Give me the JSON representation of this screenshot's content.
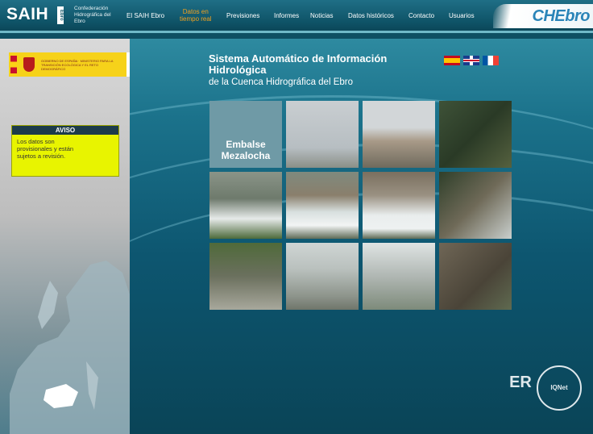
{
  "header": {
    "logo": "SAIH",
    "logo_sub": "Ebro",
    "org": "Confederación Hidrográfica del Ebro",
    "brand": "CHEbro",
    "nav": [
      {
        "label": "El SAIH Ebro"
      },
      {
        "label": "Datos en\ntiempo real"
      },
      {
        "label": "Previsiones"
      },
      {
        "label": "Informes"
      },
      {
        "label": "Noticias"
      },
      {
        "label": "Datos históricos"
      },
      {
        "label": "Contacto"
      },
      {
        "label": "Usuarios"
      }
    ]
  },
  "sidebar": {
    "ministry_logo_text": "GOBIERNO DE ESPAÑA · MINISTERIO PARA LA TRANSICIÓN ECOLÓGICA Y EL RETO DEMOGRÁFICO",
    "che_logo_text": "CONFEDERACIÓN HIDROGRÁFICA DEL EBRO",
    "aviso_title": "AVISO",
    "aviso_text": "Los datos son provisionales y están sujetos a revisión."
  },
  "main": {
    "title": "Sistema Automático de Información Hidrológica",
    "subtitle": "de la Cuenca Hidrográfica del Ebro",
    "languages": [
      "es",
      "en",
      "fr"
    ],
    "feature_label": "Embalse Mezalocha"
  },
  "footer": {
    "cert_er": "ER",
    "cert_iqnet": "IQNet"
  },
  "colors": {
    "header_bg": "#0f5468",
    "active_nav": "#f0a020",
    "aviso_bg": "#e8f400",
    "main_bg": "#0d5670"
  }
}
